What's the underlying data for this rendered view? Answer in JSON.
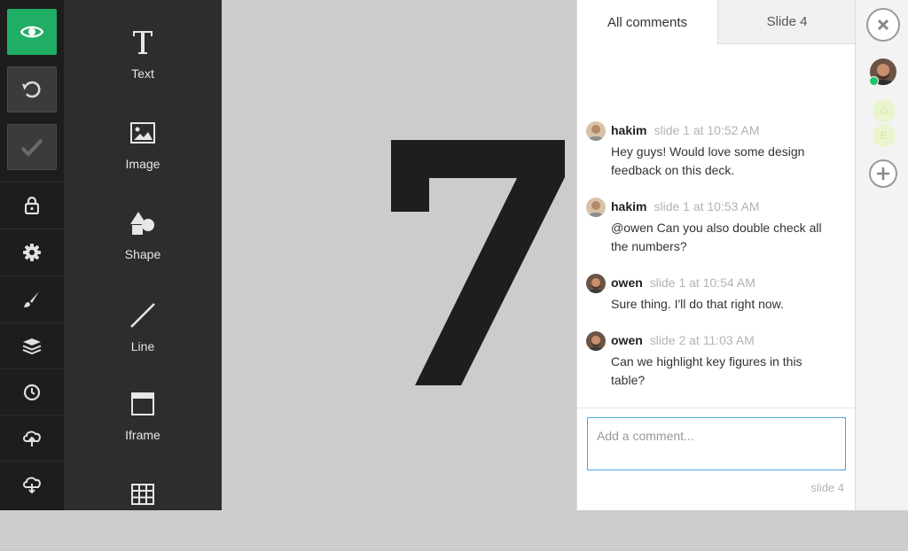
{
  "toolbar": {
    "buttons": [
      "eye-icon",
      "undo-icon",
      "checkmark-icon"
    ],
    "items": [
      "lock-icon",
      "gear-icon",
      "brush-icon",
      "layers-icon",
      "clock-icon",
      "cloud-upload-icon",
      "cloud-download-icon"
    ],
    "accent_color": "#1fae63"
  },
  "blocks": [
    {
      "label": "Text",
      "icon": "text-icon"
    },
    {
      "label": "Image",
      "icon": "image-icon"
    },
    {
      "label": "Shape",
      "icon": "shape-icon"
    },
    {
      "label": "Line",
      "icon": "line-icon"
    },
    {
      "label": "Iframe",
      "icon": "iframe-icon"
    },
    {
      "label": "",
      "icon": "table-icon"
    }
  ],
  "slide": {
    "content": "7",
    "background": "#cccccc",
    "text_color": "#1e1e1e"
  },
  "comments_panel": {
    "tabs": [
      {
        "label": "All comments",
        "active": true
      },
      {
        "label": "Slide 4",
        "active": false
      }
    ],
    "comments": [
      {
        "author": "hakim",
        "meta": "slide 1 at 10:52 AM",
        "text": "Hey guys! Would love some design feedback on this deck."
      },
      {
        "author": "hakim",
        "meta": "slide 1 at 10:53 AM",
        "text": "@owen Can you also double check all the numbers?"
      },
      {
        "author": "owen",
        "meta": "slide 1 at 10:54 AM",
        "text": "Sure thing. I'll do that right now."
      },
      {
        "author": "owen",
        "meta": "slide 2 at 11:03 AM",
        "text": "Can we highlight key figures in this table?"
      }
    ],
    "input": {
      "placeholder": "Add a comment...",
      "value": ""
    },
    "slide_tag": "slide 4",
    "input_border_color": "#4ba6e8"
  },
  "rail": {
    "close_icon": "close-icon",
    "collaborators": [
      "G",
      "E"
    ],
    "add_icon": "add-icon",
    "online_color": "#1fc36e"
  }
}
